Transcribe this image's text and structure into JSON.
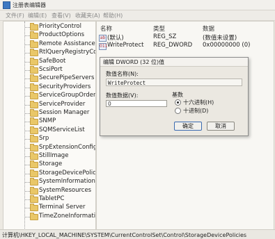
{
  "window": {
    "title": "注册表编辑器"
  },
  "menu": [
    "文件(F)",
    "编辑(E)",
    "查看(V)",
    "收藏夹(A)",
    "帮助(H)"
  ],
  "tree": {
    "items": [
      "PriorityControl",
      "ProductOptions",
      "Remote Assistance",
      "RtlQueryRegistryConf",
      "SafeBoot",
      "ScsiPort",
      "SecurePipeServers",
      "SecurityProviders",
      "ServiceGroupOrder",
      "ServiceProvider",
      "Session Manager",
      "SNMP",
      "SQMServiceList",
      "Srp",
      "SrpExtensionConfig",
      "StillImage",
      "Storage",
      "StorageDevicePolicie",
      "SystemInformation",
      "SystemResources",
      "TabletPC",
      "Terminal Server",
      "TimeZoneInformatior"
    ]
  },
  "list": {
    "headers": {
      "name": "名称",
      "type": "类型",
      "data": "数据"
    },
    "rows": [
      {
        "icon": "ab",
        "name": "(默认)",
        "type": "REG_SZ",
        "data": "(数值未设置)"
      },
      {
        "icon": "011",
        "name": "WriteProtect",
        "type": "REG_DWORD",
        "data": "0x00000000 (0)"
      }
    ]
  },
  "dialog": {
    "title": "编辑 DWORD (32 位)值",
    "name_label": "数值名称(N):",
    "name_value": "WriteProtect",
    "data_label": "数值数据(V):",
    "data_value": "0",
    "base_label": "基数",
    "hex_label": "十六进制(H)",
    "dec_label": "十进制(D)",
    "selected_base": "hex",
    "ok": "确定",
    "cancel": "取消"
  },
  "statusbar": {
    "path": "计算机\\HKEY_LOCAL_MACHINE\\SYSTEM\\CurrentControlSet\\Control\\StorageDevicePolicies"
  }
}
